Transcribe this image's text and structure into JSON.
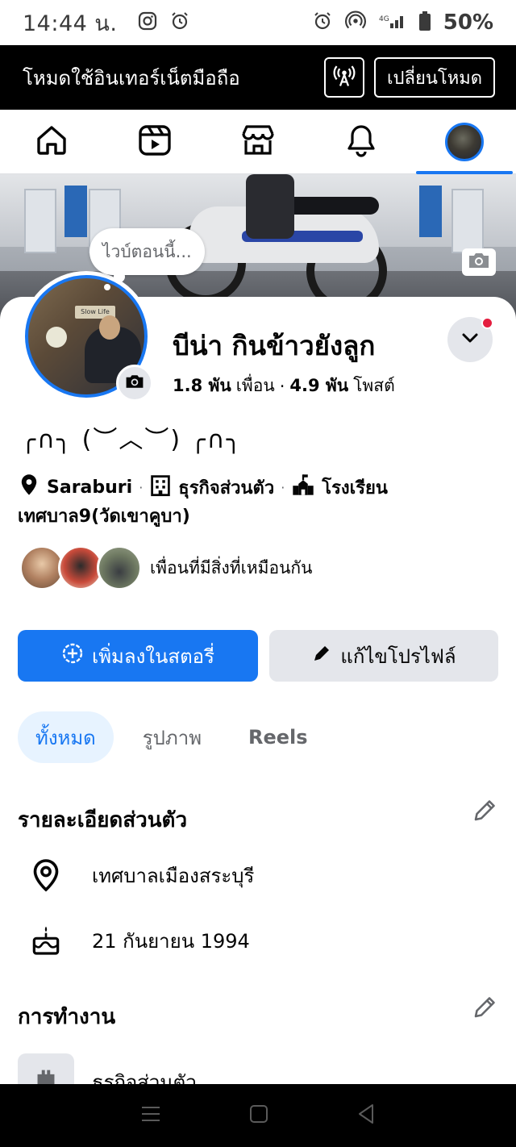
{
  "status_bar": {
    "time": "14:44 น.",
    "battery": "50%",
    "icons": [
      "instagram-icon",
      "alarm-icon",
      "alarm-icon",
      "hotspot-icon",
      "signal-icon",
      "battery-icon"
    ]
  },
  "data_banner": {
    "text": "โหมดใช้อินเทอร์เน็ตมือถือ",
    "switch_label": "เปลี่ยนโหมด"
  },
  "top_nav": {
    "items": [
      "home-icon",
      "video-icon",
      "marketplace-icon",
      "notifications-icon",
      "profile-avatar"
    ],
    "active_index": 4
  },
  "note": {
    "text": "ไวบ์ตอนนี้..."
  },
  "profile": {
    "name": "บีน่า กินข้าวยังลูก",
    "friends_count": "1.8 พัน",
    "friends_label": "เพื่อน",
    "dot": "·",
    "posts_count": "4.9 พัน",
    "posts_label": "โพสต์",
    "bio": "╭∩╮ (︶︿︶) ╭∩╮",
    "location": "Saraburi",
    "work": "ธุรกิจส่วนตัว",
    "school": "โรงเรียนเทศบาล9(วัดเขาคูบา)",
    "sep": "·",
    "mutual_text": "เพื่อนที่มีสิ่งที่เหมือนกัน",
    "profile_pic_sign": "Slow Life"
  },
  "buttons": {
    "add_story": "เพิ่มลงในสตอรี่",
    "edit_profile": "แก้ไขโปรไฟล์"
  },
  "filters": {
    "all": "ทั้งหมด",
    "photos": "รูปภาพ",
    "reels": "Reels"
  },
  "details": {
    "title": "รายละเอียดส่วนตัว",
    "hometown": "เทศบาลเมืองสระบุรี",
    "birthday": "21 กันยายน  1994"
  },
  "work_section": {
    "title": "การทำงาน",
    "job": "ธุรกิจส่วนตัว"
  },
  "colors": {
    "accent": "#1877f2",
    "chip_bg": "#e7f3ff",
    "secondary_bg": "#e4e6eb",
    "notification_dot": "#e41e3f"
  }
}
